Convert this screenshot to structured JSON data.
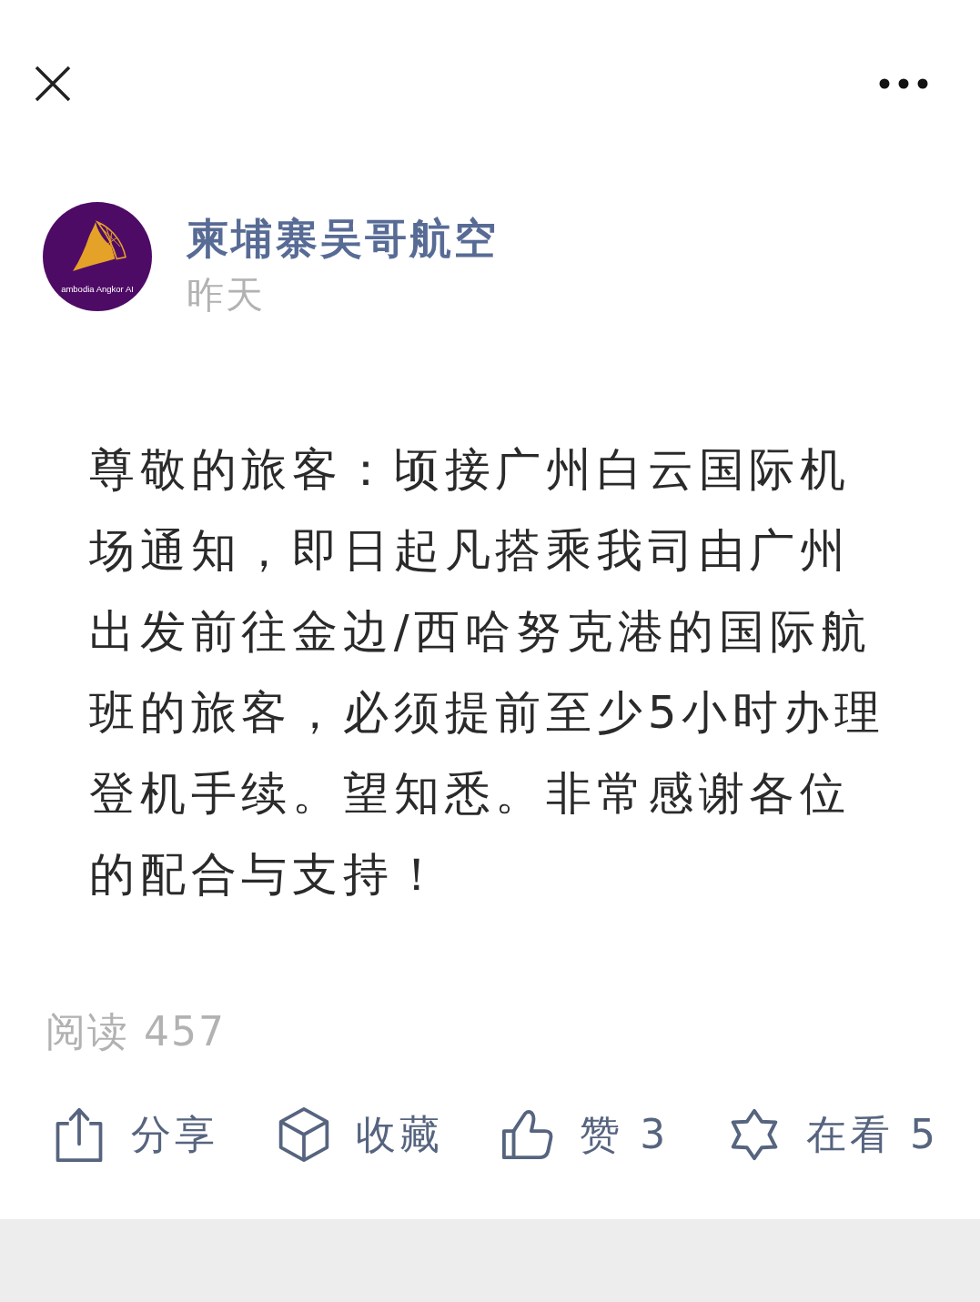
{
  "account": {
    "avatar": {
      "logo_text": "ambodia Angkor AI"
    },
    "name": "柬埔寨吴哥航空",
    "time": "昨天"
  },
  "article": {
    "body": "尊敬的旅客：顷接广州白云国际机场通知，即日起凡搭乘我司由广州出发前往金边/西哈努克港的国际航班的旅客，必须提前至少5小时办理登机手续。望知悉。非常感谢各位的配合与支持！"
  },
  "read_count": "阅读 457",
  "actions": [
    {
      "kind": "share",
      "label": "分享"
    },
    {
      "kind": "collect",
      "label": "收藏"
    },
    {
      "kind": "like",
      "label": "赞",
      "count": "3"
    },
    {
      "kind": "watching",
      "label": "在看",
      "count": "5"
    }
  ]
}
